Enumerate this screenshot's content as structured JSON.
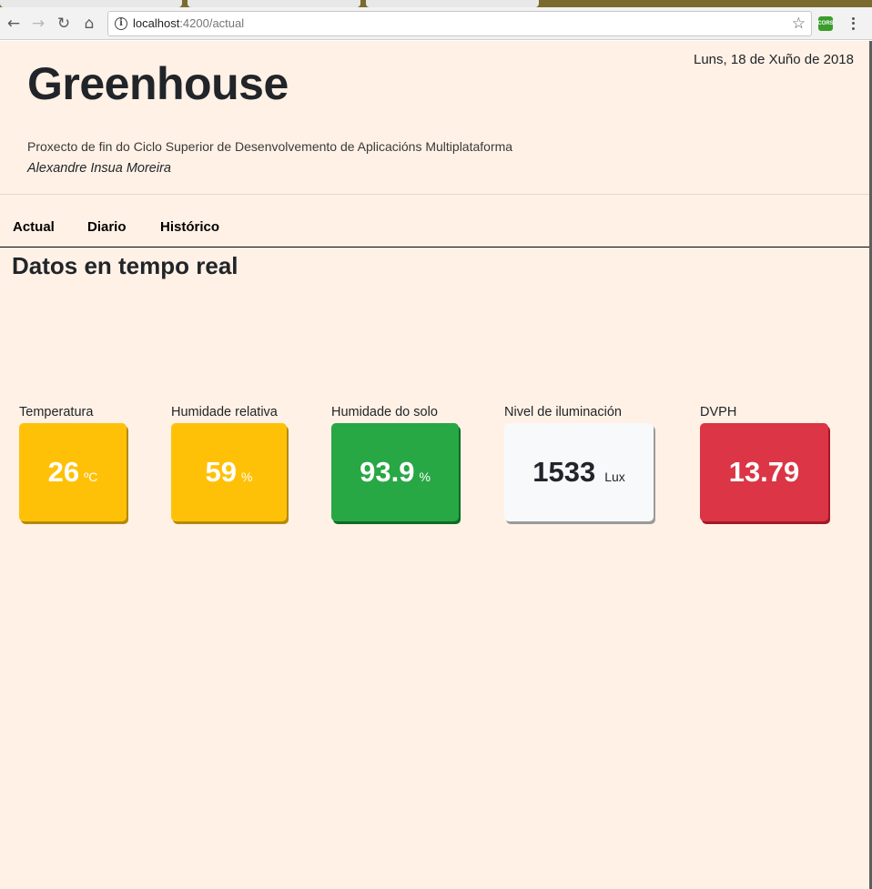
{
  "browser": {
    "url_host": "localhost",
    "url_rest": ":4200/actual"
  },
  "header": {
    "title": "Greenhouse",
    "subtitle": "Proxecto de fin do Ciclo Superior de Desenvolvemento de Aplicacións Multiplataforma",
    "author": "Alexandre Insua Moreira",
    "date": "Luns, 18 de Xuño de 2018"
  },
  "nav": {
    "items": [
      {
        "label": "Actual"
      },
      {
        "label": "Diario"
      },
      {
        "label": "Histórico"
      }
    ]
  },
  "main": {
    "section_title": "Datos en tempo real",
    "sensors": [
      {
        "label": "Temperatura",
        "value": "26",
        "unit": "ºC",
        "status": "warning"
      },
      {
        "label": "Humidade relativa",
        "value": "59",
        "unit": "%",
        "status": "warning"
      },
      {
        "label": "Humidade do solo",
        "value": "93.9",
        "unit": "%",
        "status": "success"
      },
      {
        "label": "Nivel de iluminación",
        "value": "1533",
        "unit": "Lux",
        "status": "light"
      },
      {
        "label": "DVPH",
        "value": "13.79",
        "unit": "",
        "status": "danger"
      }
    ]
  },
  "colors": {
    "page_background": "#fff1e6",
    "warning": "#ffc107",
    "success": "#28a745",
    "light": "#f8f9fa",
    "danger": "#dc3545"
  },
  "icons": [
    "back-icon",
    "forward-icon",
    "reload-icon",
    "home-icon",
    "info-icon",
    "star-icon",
    "cors-extension-icon",
    "menu-icon"
  ]
}
